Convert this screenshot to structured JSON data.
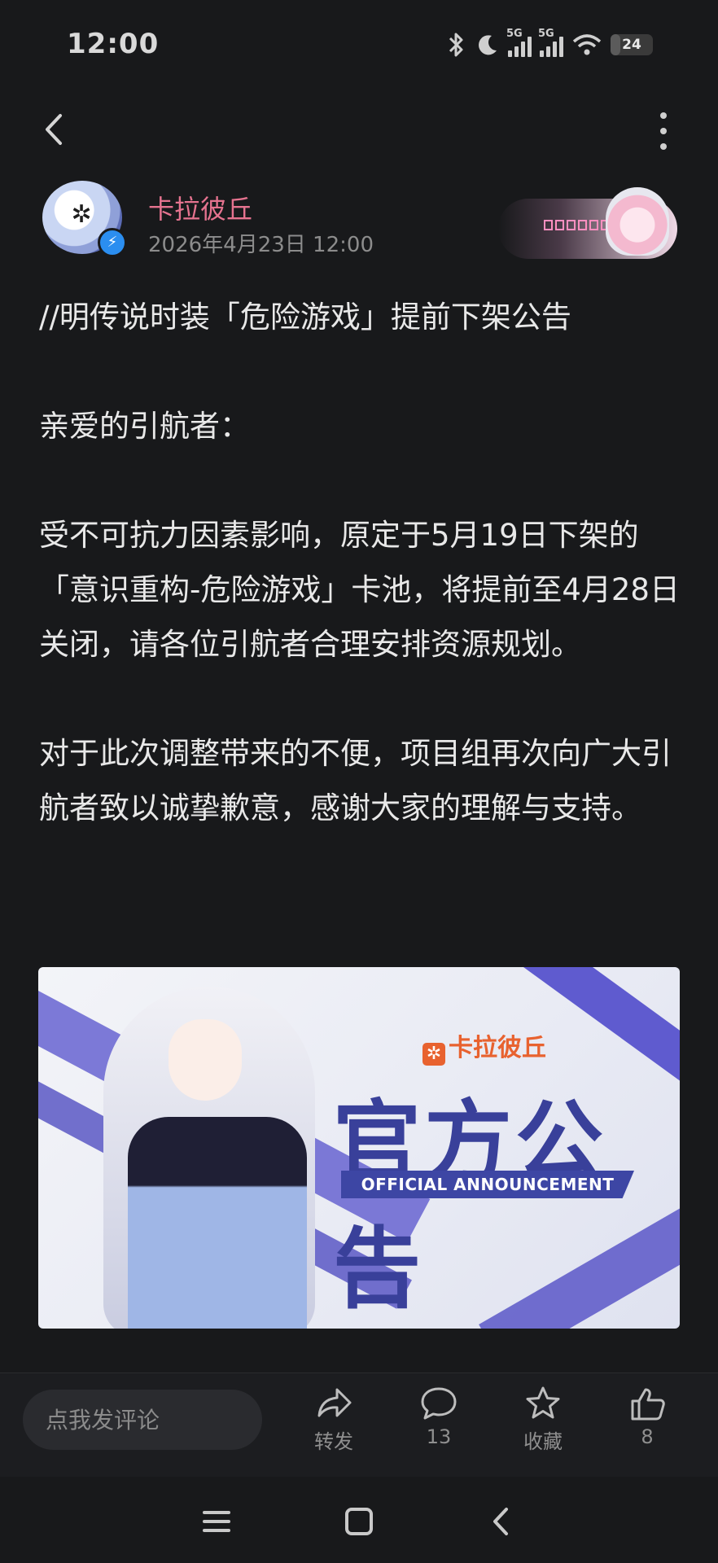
{
  "status_bar": {
    "time": "12:00",
    "battery": "24",
    "network_1": "5G",
    "network_2": "5G"
  },
  "post": {
    "author": "卡拉彼丘",
    "date": "2026年4月23日 12:00",
    "paragraphs": [
      "//明传说时装「危险游戏」提前下架公告",
      "亲爱的引航者：",
      "受不可抗力因素影响，原定于5月19日下架的「意识重构-危险游戏」卡池，将提前至4月28日关闭，请各位引航者合理安排资源规划。",
      "对于此次调整带来的不便，项目组再次向广大引航者致以诚挚歉意，感谢大家的理解与支持。"
    ],
    "banner": {
      "brand": "卡拉彼丘",
      "title": "官方公告",
      "subtitle": "OFFICIAL ANNOUNCEMENT"
    }
  },
  "bottom_bar": {
    "comment_placeholder": "点我发评论",
    "actions": [
      {
        "icon": "share-icon",
        "label": "转发"
      },
      {
        "icon": "comment-icon",
        "label": "13"
      },
      {
        "icon": "star-icon",
        "label": "收藏"
      },
      {
        "icon": "thumbs-up-icon",
        "label": "8"
      }
    ]
  },
  "colors": {
    "author_name": "#e5738f",
    "background": "#18191b",
    "banner_accent": "#39409a"
  }
}
